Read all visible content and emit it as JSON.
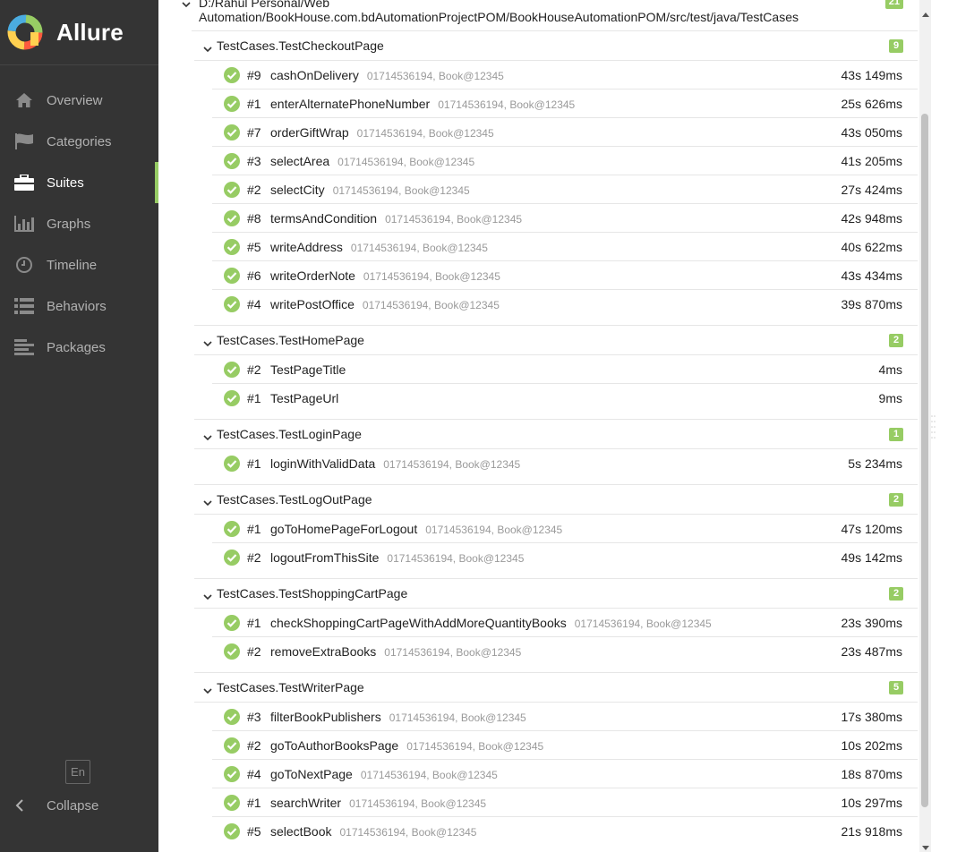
{
  "brand": {
    "name": "Allure"
  },
  "nav": [
    {
      "label": "Overview",
      "icon": "home-icon",
      "active": false
    },
    {
      "label": "Categories",
      "icon": "flag-icon",
      "active": false
    },
    {
      "label": "Suites",
      "icon": "briefcase-icon",
      "active": true
    },
    {
      "label": "Graphs",
      "icon": "bar-chart-icon",
      "active": false
    },
    {
      "label": "Timeline",
      "icon": "clock-icon",
      "active": false
    },
    {
      "label": "Behaviors",
      "icon": "list-icon",
      "active": false
    },
    {
      "label": "Packages",
      "icon": "align-left-icon",
      "active": false
    }
  ],
  "footer": {
    "lang": "En",
    "collapse": "Collapse"
  },
  "root": {
    "title_line1": "D:/Rahul Personal/Web",
    "title_line2": "Automation/BookHouse.com.bdAutomationProjectPOM/BookHouseAutomationPOM/src/test/java/TestCases",
    "count": "21"
  },
  "colors": {
    "passed": "#97cc64",
    "sidebar": "#343434"
  },
  "groups": [
    {
      "name": "TestCases.TestCheckoutPage",
      "count": "9",
      "tests": [
        {
          "num": "#9",
          "name": "cashOnDelivery",
          "params": "01714536194, Book@12345",
          "duration": "43s 149ms"
        },
        {
          "num": "#1",
          "name": "enterAlternatePhoneNumber",
          "params": "01714536194, Book@12345",
          "duration": "25s 626ms"
        },
        {
          "num": "#7",
          "name": "orderGiftWrap",
          "params": "01714536194, Book@12345",
          "duration": "43s 050ms"
        },
        {
          "num": "#3",
          "name": "selectArea",
          "params": "01714536194, Book@12345",
          "duration": "41s 205ms"
        },
        {
          "num": "#2",
          "name": "selectCity",
          "params": "01714536194, Book@12345",
          "duration": "27s 424ms"
        },
        {
          "num": "#8",
          "name": "termsAndCondition",
          "params": "01714536194, Book@12345",
          "duration": "42s 948ms"
        },
        {
          "num": "#5",
          "name": "writeAddress",
          "params": "01714536194, Book@12345",
          "duration": "40s 622ms"
        },
        {
          "num": "#6",
          "name": "writeOrderNote",
          "params": "01714536194, Book@12345",
          "duration": "43s 434ms"
        },
        {
          "num": "#4",
          "name": "writePostOffice",
          "params": "01714536194, Book@12345",
          "duration": "39s 870ms"
        }
      ]
    },
    {
      "name": "TestCases.TestHomePage",
      "count": "2",
      "tests": [
        {
          "num": "#2",
          "name": "TestPageTitle",
          "params": "",
          "duration": "4ms"
        },
        {
          "num": "#1",
          "name": "TestPageUrl",
          "params": "",
          "duration": "9ms"
        }
      ]
    },
    {
      "name": "TestCases.TestLoginPage",
      "count": "1",
      "tests": [
        {
          "num": "#1",
          "name": "loginWithValidData",
          "params": "01714536194, Book@12345",
          "duration": "5s 234ms"
        }
      ]
    },
    {
      "name": "TestCases.TestLogOutPage",
      "count": "2",
      "tests": [
        {
          "num": "#1",
          "name": "goToHomePageForLogout",
          "params": "01714536194, Book@12345",
          "duration": "47s 120ms"
        },
        {
          "num": "#2",
          "name": "logoutFromThisSite",
          "params": "01714536194, Book@12345",
          "duration": "49s 142ms"
        }
      ]
    },
    {
      "name": "TestCases.TestShoppingCartPage",
      "count": "2",
      "tests": [
        {
          "num": "#1",
          "name": "checkShoppingCartPageWithAddMoreQuantityBooks",
          "params": "01714536194, Book@12345",
          "duration": "23s 390ms"
        },
        {
          "num": "#2",
          "name": "removeExtraBooks",
          "params": "01714536194, Book@12345",
          "duration": "23s 487ms"
        }
      ]
    },
    {
      "name": "TestCases.TestWriterPage",
      "count": "5",
      "tests": [
        {
          "num": "#3",
          "name": "filterBookPublishers",
          "params": "01714536194, Book@12345",
          "duration": "17s 380ms"
        },
        {
          "num": "#2",
          "name": "goToAuthorBooksPage",
          "params": "01714536194, Book@12345",
          "duration": "10s 202ms"
        },
        {
          "num": "#4",
          "name": "goToNextPage",
          "params": "01714536194, Book@12345",
          "duration": "18s 870ms"
        },
        {
          "num": "#1",
          "name": "searchWriter",
          "params": "01714536194, Book@12345",
          "duration": "10s 297ms"
        },
        {
          "num": "#5",
          "name": "selectBook",
          "params": "01714536194, Book@12345",
          "duration": "21s 918ms"
        }
      ]
    }
  ]
}
